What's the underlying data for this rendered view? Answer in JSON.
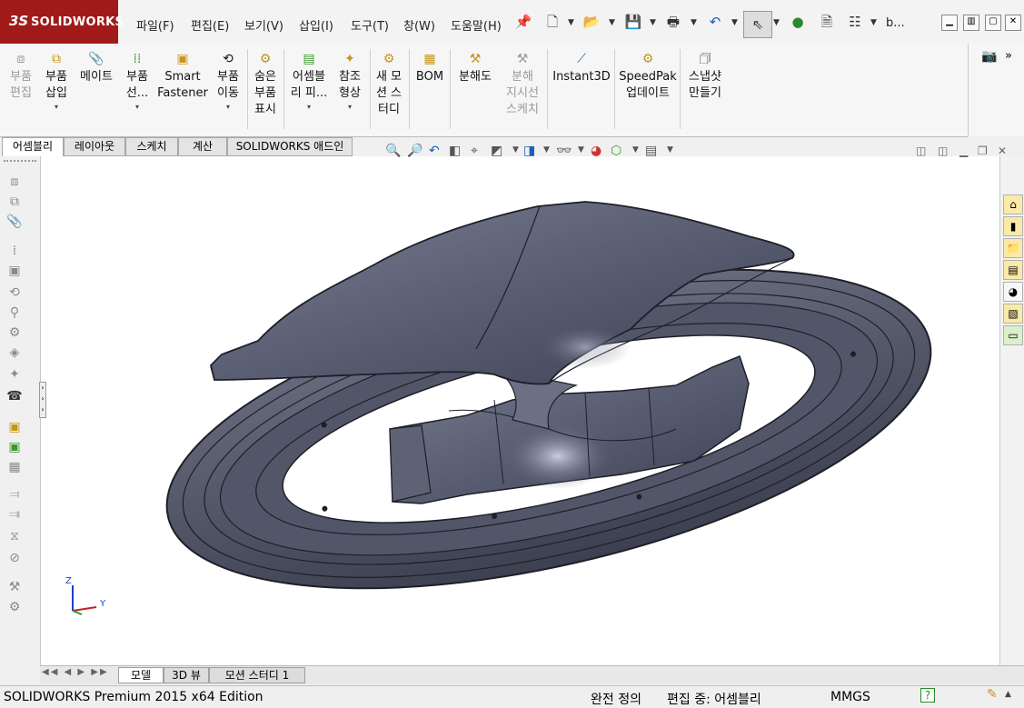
{
  "app": {
    "logo_mark": "3S",
    "logo_text": "SOLIDWORKS"
  },
  "menu": [
    "파일(F)",
    "편집(E)",
    "보기(V)",
    "삽입(I)",
    "도구(T)",
    "창(W)",
    "도움말(H)"
  ],
  "titlebar": {
    "doc_name": "b..."
  },
  "command_manager": [
    {
      "label1": "부품",
      "label2": "편집",
      "icon": "edit-part-icon",
      "disabled": true
    },
    {
      "label1": "부품",
      "label2": "삽입",
      "icon": "insert-component-icon",
      "dropdown": true
    },
    {
      "label1": "메이트",
      "label2": "",
      "icon": "mate-icon"
    },
    {
      "label1": "부품",
      "label2": "선...",
      "icon": "linear-pattern-icon",
      "dropdown": true
    },
    {
      "label1": "Smart",
      "label2": "Fastener",
      "icon": "smart-fastener-icon"
    },
    {
      "label1": "부품",
      "label2": "이동",
      "icon": "move-component-icon",
      "dropdown": true
    },
    {
      "label1": "숨은",
      "label2": "부품",
      "label3": "표시",
      "icon": "show-hidden-icon"
    },
    {
      "label1": "어셈블",
      "label2": "리 피...",
      "icon": "assembly-feature-icon",
      "dropdown": true
    },
    {
      "label1": "참조",
      "label2": "형상",
      "icon": "reference-geometry-icon",
      "dropdown": true
    },
    {
      "label1": "새 모",
      "label2": "션 스",
      "label3": "터디",
      "icon": "motion-study-icon"
    },
    {
      "label1": "BOM",
      "label2": "",
      "icon": "bom-icon"
    },
    {
      "label1": "분해도",
      "label2": "",
      "icon": "exploded-view-icon"
    },
    {
      "label1": "분해",
      "label2": "지시선",
      "label3": "스케치",
      "icon": "explode-line-icon",
      "disabled": true
    },
    {
      "label1": "Instant3D",
      "label2": "",
      "icon": "instant3d-icon"
    },
    {
      "label1": "SpeedPak",
      "label2": "업데이트",
      "icon": "speedpak-icon"
    },
    {
      "label1": "스냅샷",
      "label2": "만들기",
      "icon": "snapshot-icon"
    }
  ],
  "tabs": [
    "어셈블리",
    "레이아웃",
    "스케치",
    "계산",
    "SOLIDWORKS 애드인"
  ],
  "bottom_tabs": [
    "모델",
    "3D 뷰",
    "모션 스터디 1"
  ],
  "triad": {
    "z": "Z",
    "y": "Y"
  },
  "status": {
    "left": "SOLIDWORKS Premium 2015 x64 Edition",
    "fully_defined": "완전 정의",
    "editing": "편집 중: 어셈블리",
    "units": "MMGS",
    "help": "?"
  }
}
